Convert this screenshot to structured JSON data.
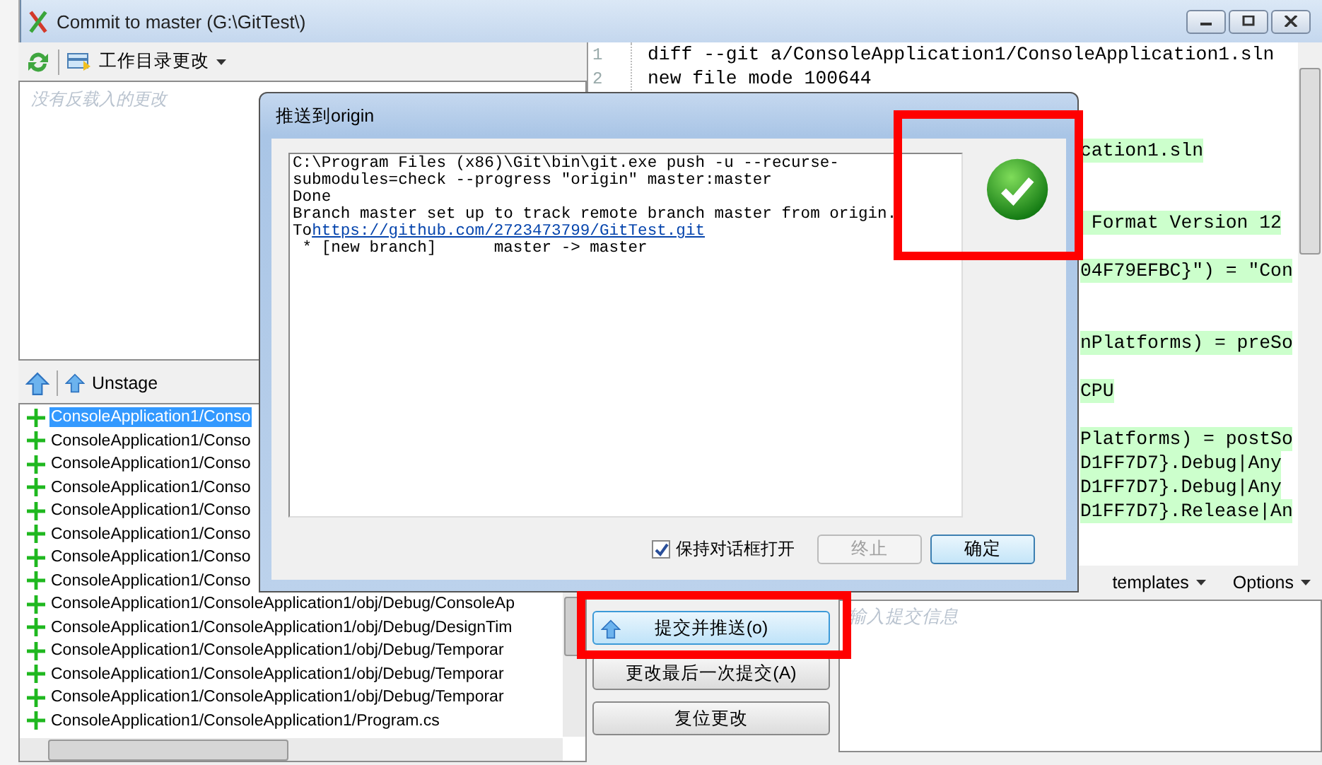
{
  "window": {
    "title": "Commit to master (G:\\GitTest\\)"
  },
  "unstaged": {
    "toolbar_label": "工作目录更改",
    "placeholder": "没有反载入的更改"
  },
  "staged": {
    "toolbar_label": "Unstage",
    "files": [
      {
        "path": "ConsoleApplication1/Conso",
        "selected": true
      },
      {
        "path": "ConsoleApplication1/Conso",
        "selected": false
      },
      {
        "path": "ConsoleApplication1/Conso",
        "selected": false
      },
      {
        "path": "ConsoleApplication1/Conso",
        "selected": false
      },
      {
        "path": "ConsoleApplication1/Conso",
        "selected": false
      },
      {
        "path": "ConsoleApplication1/Conso",
        "selected": false
      },
      {
        "path": "ConsoleApplication1/Conso",
        "selected": false
      },
      {
        "path": "ConsoleApplication1/Conso",
        "selected": false
      },
      {
        "path": "ConsoleApplication1/ConsoleApplication1/obj/Debug/ConsoleAp",
        "selected": false
      },
      {
        "path": "ConsoleApplication1/ConsoleApplication1/obj/Debug/DesignTim",
        "selected": false
      },
      {
        "path": "ConsoleApplication1/ConsoleApplication1/obj/Debug/Temporar",
        "selected": false
      },
      {
        "path": "ConsoleApplication1/ConsoleApplication1/obj/Debug/Temporar",
        "selected": false
      },
      {
        "path": "ConsoleApplication1/ConsoleApplication1/obj/Debug/Temporar",
        "selected": false
      },
      {
        "path": "ConsoleApplication1/ConsoleApplication1/Program.cs",
        "selected": false
      }
    ]
  },
  "diff": {
    "lines": [
      {
        "kind": "full",
        "number": "1",
        "text": "diff --git a/ConsoleApplication1/ConsoleApplication1.sln"
      },
      {
        "kind": "full",
        "number": "2",
        "text": "new file mode 100644"
      },
      {
        "kind": "blank"
      },
      {
        "kind": "blank"
      },
      {
        "kind": "fragment",
        "text": "cation1.sln",
        "added": true
      },
      {
        "kind": "blank"
      },
      {
        "kind": "blank"
      },
      {
        "kind": "fragment",
        "text": " Format Version 12",
        "added": true
      },
      {
        "kind": "blank"
      },
      {
        "kind": "fragment",
        "text": "04F79EFBC}\") = \"Con",
        "added": true
      },
      {
        "kind": "blank"
      },
      {
        "kind": "blank"
      },
      {
        "kind": "fragment",
        "text": "nPlatforms) = preSo",
        "added": true
      },
      {
        "kind": "blank"
      },
      {
        "kind": "fragment",
        "text": "CPU",
        "added": true
      },
      {
        "kind": "blank"
      },
      {
        "kind": "fragment",
        "text": "Platforms) = postSo",
        "added": true
      },
      {
        "kind": "fragment",
        "text": "D1FF7D7}.Debug|Any",
        "added": true
      },
      {
        "kind": "fragment",
        "text": "D1FF7D7}.Debug|Any",
        "added": true
      },
      {
        "kind": "fragment",
        "text": "D1FF7D7}.Release|An",
        "added": true
      }
    ]
  },
  "commit": {
    "buttons": [
      {
        "label": "提交并推送(o)",
        "kind": "push"
      },
      {
        "label": "更改最后一次提交(A)",
        "kind": "plain"
      },
      {
        "label": "复位更改",
        "kind": "plain"
      }
    ],
    "menus": [
      "templates",
      "Options"
    ],
    "message": {
      "placeholder": "输入提交信息"
    }
  },
  "dialog": {
    "title": "推送到origin",
    "success": true,
    "output": [
      {
        "text": "C:\\Program Files (x86)\\Git\\bin\\git.exe push -u --recurse-"
      },
      {
        "text": "submodules=check --progress \"origin\" master:master"
      },
      {
        "text": "Done"
      },
      {
        "text": "Branch master set up to track remote branch master from origin."
      },
      {
        "text": "To",
        "link": "https://github.com/2723473799/GitTest.git"
      },
      {
        "text": " * [new branch]      master -> master"
      }
    ],
    "keep_open": {
      "label": "保持对话框打开",
      "checked": true
    },
    "buttons": [
      {
        "label": "终止",
        "disabled": true
      },
      {
        "label": "确定",
        "disabled": false
      }
    ]
  }
}
